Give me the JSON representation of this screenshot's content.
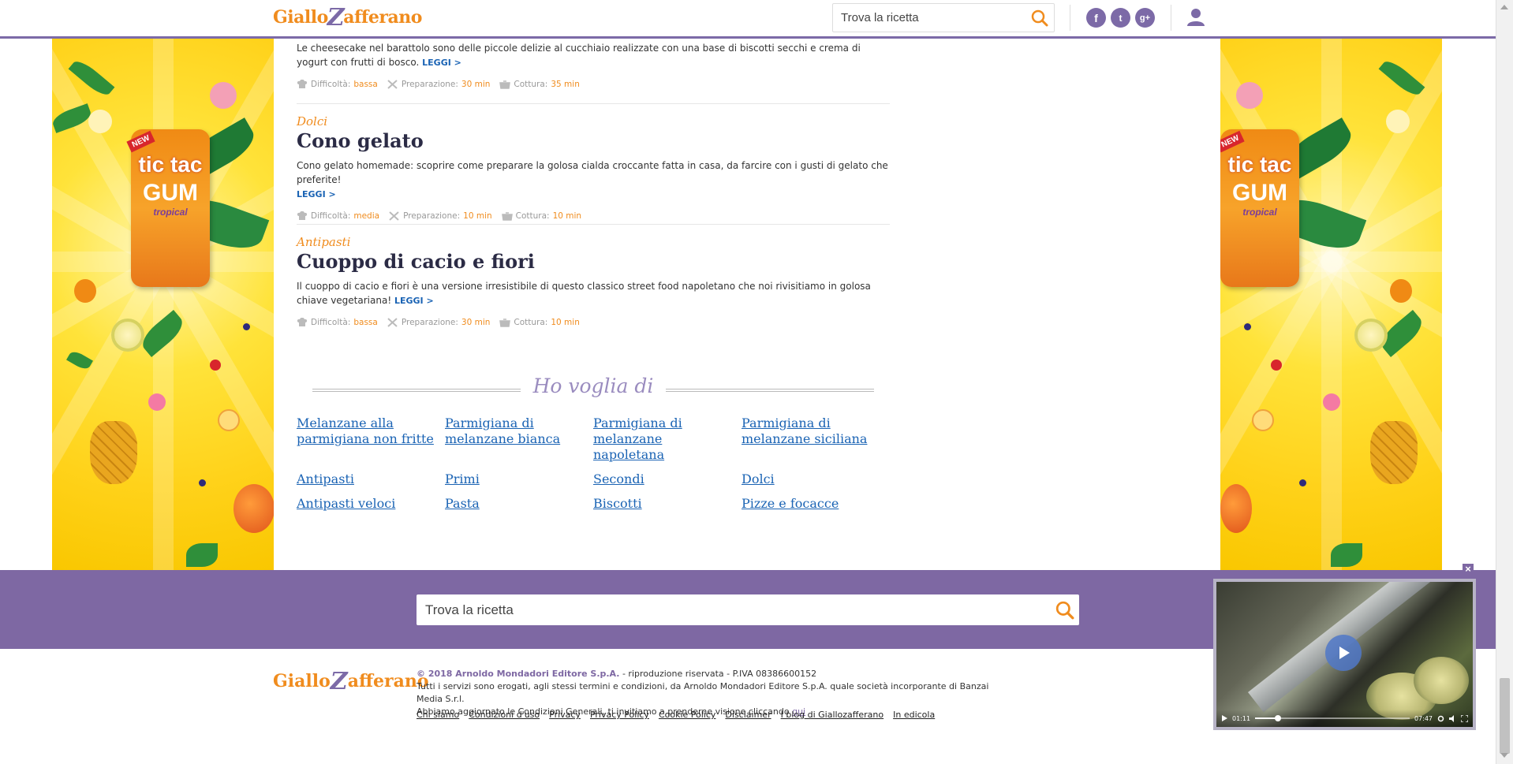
{
  "header": {
    "logo_part1": "Giallo",
    "logo_z": "Z",
    "logo_part2": "afferano",
    "search_placeholder": "Trova la ricetta",
    "social": [
      {
        "name": "facebook-icon",
        "glyph": "f"
      },
      {
        "name": "twitter-icon",
        "glyph": "t"
      },
      {
        "name": "google-plus-icon",
        "glyph": "g+"
      }
    ]
  },
  "ads": {
    "pack_new": "NEW",
    "pack_brand": "tic tac",
    "pack_gum": "GUM",
    "pack_flavor": "tropical"
  },
  "recipes": [
    {
      "category": "",
      "title": "",
      "description": "Le cheesecake nel barattolo sono delle piccole delizie al cucchiaio realizzate con una base di biscotti secchi e crema di yogurt con frutti di bosco.",
      "leggi": "LEGGI >",
      "difficulty_label": "Difficoltà:",
      "difficulty": "bassa",
      "prep_label": "Preparazione:",
      "prep": "30 min",
      "cook_label": "Cottura:",
      "cook": "35 min"
    },
    {
      "category": "Dolci",
      "title": "Cono gelato",
      "description": "Cono gelato homemade: scoprire come preparare la golosa cialda croccante fatta in casa, da farcire con i gusti di gelato che preferite!",
      "leggi": "LEGGI >",
      "difficulty_label": "Difficoltà:",
      "difficulty": "media",
      "prep_label": "Preparazione:",
      "prep": "10 min",
      "cook_label": "Cottura:",
      "cook": "10 min"
    },
    {
      "category": "Antipasti",
      "title": "Cuoppo di cacio e fiori",
      "description": "Il cuoppo di cacio e fiori è una versione irresistibile di questo classico street food napoletano che noi rivisitiamo in golosa chiave vegetariana!",
      "leggi": "LEGGI >",
      "difficulty_label": "Difficoltà:",
      "difficulty": "bassa",
      "prep_label": "Preparazione:",
      "prep": "30 min",
      "cook_label": "Cottura:",
      "cook": "10 min"
    }
  ],
  "ho_voglia_di": {
    "title": "Ho voglia di",
    "links": [
      "Melanzane alla parmigiana non fritte",
      "Parmigiana di melanzane bianca",
      "Parmigiana di melanzane napoletana",
      "Parmigiana di melanzane siciliana",
      "Antipasti",
      "Primi",
      "Secondi",
      "Dolci",
      "Antipasti veloci",
      "Pasta",
      "Biscotti",
      "Pizze e focacce"
    ]
  },
  "footer_search": {
    "placeholder": "Trova la ricetta"
  },
  "footer": {
    "copyright": "© 2018 Arnoldo Mondadori Editore S.p.A.",
    "rights": " - riproduzione riservata - P.IVA 08386600152",
    "line2": "Tutti i servizi sono erogati, agli stessi termini e condizioni, da Arnoldo Mondadori Editore S.p.A. quale società incorporante di Banzai Media S.r.l.",
    "line3": "Abbiamo aggiornato le Condizioni Generali, ti invitiamo a prenderne visione cliccando ",
    "qui": "qui",
    "links": [
      "Chi siamo",
      "Condizioni d'uso",
      "Privacy",
      "Privacy Policy",
      "Cookie Policy",
      "Disclaimer",
      "I blog di Giallozafferano",
      "In edicola"
    ]
  },
  "video": {
    "close": "×",
    "current_time": "01:11",
    "duration": "07:47",
    "progress": 0.15
  },
  "colors": {
    "brand_orange": "#f08c1e",
    "brand_purple": "#7e68a3",
    "link_blue": "#1a63b4"
  }
}
